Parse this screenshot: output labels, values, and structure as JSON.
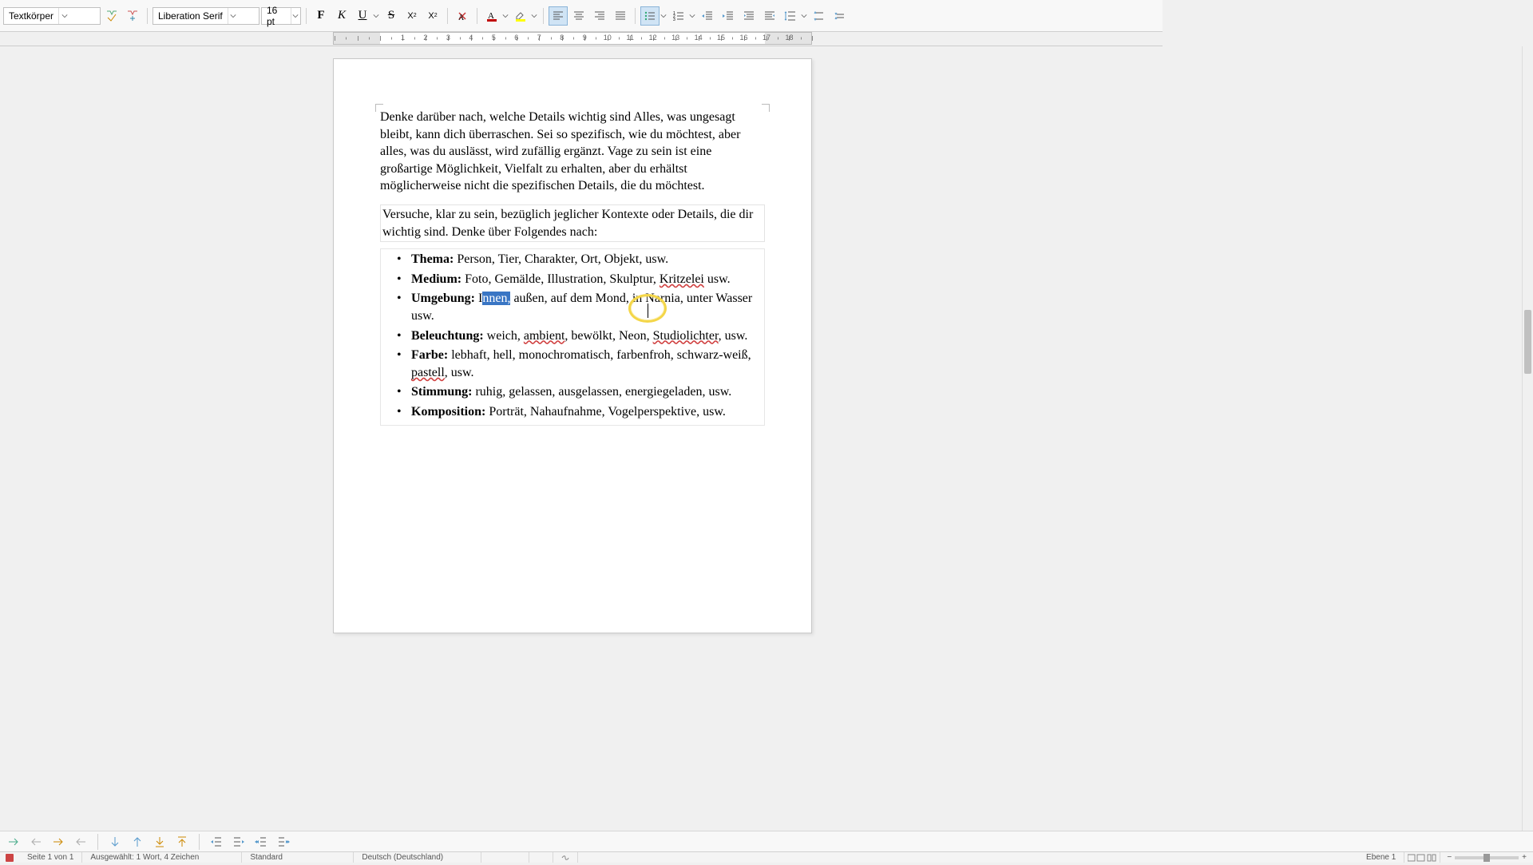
{
  "toolbar": {
    "paragraph_style": "Textkörper",
    "font_name": "Liberation Serif",
    "font_size": "16 pt",
    "bold": "B",
    "italic": "K",
    "underline": "U",
    "strike": "S",
    "super": "x²",
    "sub": "x₂",
    "clear_fmt": "A",
    "font_color": "#c00000",
    "highlight_color": "#ffff00"
  },
  "ruler": {
    "numbers": [
      "1",
      "1",
      "2",
      "3",
      "4",
      "5",
      "6",
      "7",
      "8",
      "9",
      "10",
      "11",
      "12",
      "13",
      "14",
      "15",
      "16",
      "17",
      "18"
    ]
  },
  "doc": {
    "p1": "Denke darüber nach, welche Details wichtig sind Alles, was ungesagt bleibt, kann dich überraschen. Sei so spezifisch, wie du möchtest, aber alles, was du auslässt, wird zufällig ergänzt. Vage zu sein ist eine großartige Möglichkeit, Vielfalt zu erhalten, aber du erhältst möglicherweise nicht die spezifischen Details, die du möchtest.",
    "p2": "Versuche, klar zu sein, bezüglich jeglicher Kontexte oder Details, die dir wichtig sind. Denke über Folgendes nach:",
    "items": {
      "thema_label": "Thema:",
      "thema_text": " Person, Tier, Charakter, Ort, Objekt, usw.",
      "medium_label": "Medium:",
      "medium_text_a": " Foto, Gemälde, Illustration, Skulptur, ",
      "medium_spell": "Kritzelei",
      "medium_text_b": " usw.",
      "umgebung_label": "Umgebung:",
      "umgebung_pre": " I",
      "umgebung_sel": "nnen,",
      "umgebung_mid": " außen, auf dem Mond, in Narnia, unter Wasser usw.",
      "beleuchtung_label": "Beleuchtung:",
      "beleuchtung_a": " weich, ",
      "beleuchtung_sp1": "ambient",
      "beleuchtung_b": ", bewölkt, Neon, ",
      "beleuchtung_sp2": "Studiolichter",
      "beleuchtung_c": ", usw.",
      "farbe_label": "Farbe:",
      "farbe_a": " lebhaft, hell, monochromatisch, farbenfroh, schwarz-weiß, ",
      "farbe_sp": "pastell",
      "farbe_b": ", usw.",
      "stimmung_label": "Stimmung:",
      "stimmung_text": " ruhig, gelassen, ausgelassen, energiegeladen, usw.",
      "komposition_label": "Komposition:",
      "komposition_text": " Porträt, Nahaufnahme, Vogelperspektive, usw."
    }
  },
  "status": {
    "page": "Seite 1 von 1",
    "selection": "Ausgewählt: 1 Wort, 4 Zeichen",
    "style": "Standard",
    "lang": "Deutsch (Deutschland)",
    "view": "Ebene 1"
  }
}
